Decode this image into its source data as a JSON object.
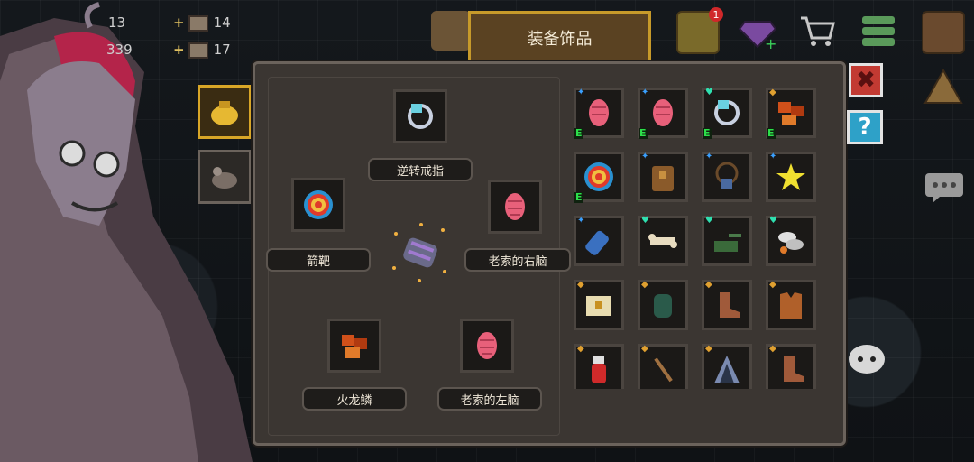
{
  "resources": {
    "top_left_a": "13",
    "top_left_b": "339",
    "item_a_count": "14",
    "item_b_count": "17",
    "plus": "+"
  },
  "header": {
    "title": "装备饰品",
    "notification_count": "1"
  },
  "equipped": {
    "top": {
      "label": "逆转戒指",
      "icon": "ring-icon"
    },
    "left": {
      "label": "箭靶",
      "icon": "target-icon"
    },
    "right": {
      "label": "老索的右脑",
      "icon": "brain-icon"
    },
    "bottom_left": {
      "label": "火龙鳞",
      "icon": "dragon-scale-icon"
    },
    "bottom_right": {
      "label": "老索的左脑",
      "icon": "brain-icon"
    }
  },
  "buttons": {
    "close": "✖",
    "help": "?"
  },
  "inventory": [
    {
      "icon": "brain-icon",
      "mark": "✦",
      "mark_color": "#3aa0ff",
      "equipped": "E"
    },
    {
      "icon": "brain-icon",
      "mark": "✦",
      "mark_color": "#3aa0ff",
      "equipped": "E"
    },
    {
      "icon": "ring-icon",
      "mark": "♥",
      "mark_color": "#2fe0b0",
      "equipped": "E"
    },
    {
      "icon": "dragon-scale-icon",
      "mark": "◆",
      "mark_color": "#e0a030",
      "equipped": "E"
    },
    {
      "icon": "target-icon",
      "mark": "",
      "mark_color": "",
      "equipped": "E"
    },
    {
      "icon": "bag-icon",
      "mark": "✦",
      "mark_color": "#3aa0ff",
      "equipped": ""
    },
    {
      "icon": "amulet-icon",
      "mark": "✦",
      "mark_color": "#3aa0ff",
      "equipped": ""
    },
    {
      "icon": "star-icon",
      "mark": "✦",
      "mark_color": "#3aa0ff",
      "equipped": ""
    },
    {
      "icon": "bottle-icon",
      "mark": "✦",
      "mark_color": "#3aa0ff",
      "equipped": ""
    },
    {
      "icon": "bone-icon",
      "mark": "♥",
      "mark_color": "#2fe0b0",
      "equipped": ""
    },
    {
      "icon": "tank-icon",
      "mark": "♥",
      "mark_color": "#2fe0b0",
      "equipped": ""
    },
    {
      "icon": "wings-icon",
      "mark": "♥",
      "mark_color": "#2fe0b0",
      "equipped": ""
    },
    {
      "icon": "chest-icon",
      "mark": "◆",
      "mark_color": "#e0a030",
      "equipped": ""
    },
    {
      "icon": "glove-icon",
      "mark": "◆",
      "mark_color": "#e0a030",
      "equipped": ""
    },
    {
      "icon": "boot-icon",
      "mark": "◆",
      "mark_color": "#e0a030",
      "equipped": ""
    },
    {
      "icon": "vest-icon",
      "mark": "◆",
      "mark_color": "#e0a030",
      "equipped": ""
    },
    {
      "icon": "potion-icon",
      "mark": "◆",
      "mark_color": "#e0a030",
      "equipped": ""
    },
    {
      "icon": "staff-icon",
      "mark": "◆",
      "mark_color": "#e0a030",
      "equipped": ""
    },
    {
      "icon": "hood-icon",
      "mark": "◆",
      "mark_color": "#e0a030",
      "equipped": ""
    },
    {
      "icon": "boot-icon",
      "mark": "◆",
      "mark_color": "#e0a030",
      "equipped": ""
    }
  ]
}
